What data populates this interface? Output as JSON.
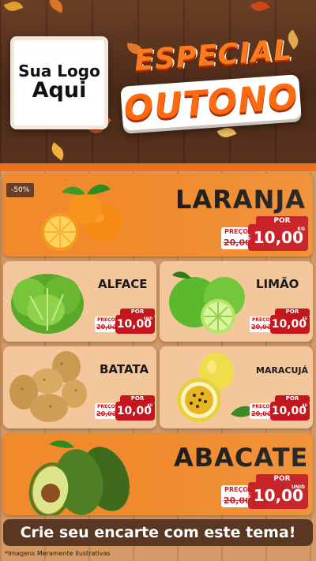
{
  "header": {
    "logo_line1": "Sua Logo",
    "logo_line2": "Aqui",
    "title_line1": "ESPECIAL",
    "title_line2": "OUTONO"
  },
  "products": [
    {
      "name": "LARANJA",
      "badge": "-50%",
      "por": "POR",
      "preco": "PREÇO",
      "old_price": "20,00",
      "currency": "R$",
      "price": "10,00",
      "unit": "KG"
    },
    {
      "name": "ALFACE",
      "por": "POR",
      "preco": "PREÇO",
      "old_price": "20,00",
      "currency": "R$",
      "price": "10,00",
      "unit": "UNID"
    },
    {
      "name": "LIMÃO",
      "por": "POR",
      "preco": "PREÇO",
      "old_price": "20,00",
      "currency": "R$",
      "price": "10,00",
      "unit": "KG"
    },
    {
      "name": "BATATA",
      "por": "POR",
      "preco": "PREÇO",
      "old_price": "20,00",
      "currency": "R$",
      "price": "10,00",
      "unit": "KG"
    },
    {
      "name": "MARACUJÁ",
      "por": "POR",
      "preco": "PREÇO",
      "old_price": "20,00",
      "currency": "R$",
      "price": "10,00",
      "unit": "KG"
    },
    {
      "name": "ABACATE",
      "por": "POR",
      "preco": "PREÇO",
      "old_price": "20,00",
      "currency": "R$",
      "price": "10,00",
      "unit": "UNID"
    }
  ],
  "footer": {
    "cta": "Crie seu encarte com este tema!",
    "disclaimer": "*Imagens Meramente Ilustrativas"
  },
  "colors": {
    "accent_orange": "#f08a2c",
    "price_red": "#c4161c",
    "wood_dark": "#5a3722"
  }
}
